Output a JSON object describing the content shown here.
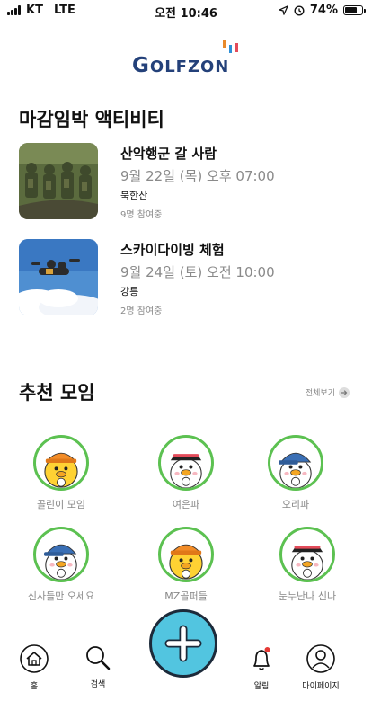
{
  "status_bar": {
    "carrier": "KT",
    "network": "LTE",
    "time": "오전 10:46",
    "battery": "74%"
  },
  "logo": {
    "text_first": "G",
    "text_rest": "OLFZON"
  },
  "deadline": {
    "title": "마감임박 액티비티",
    "items": [
      {
        "title": "산악행군 갈 사람",
        "date": "9월 22일 (목) 오후 07:00",
        "location": "북한산",
        "participants": "9명 참여중"
      },
      {
        "title": "스카이다이빙 체험",
        "date": "9월 24일 (토) 오전 10:00",
        "location": "강릉",
        "participants": "2명 참여중"
      }
    ]
  },
  "recommended": {
    "title": "추천 모임",
    "see_all": "전체보기",
    "groups": [
      {
        "name": "골린이 모임",
        "hat": "orange"
      },
      {
        "name": "여은파",
        "hat": "visor"
      },
      {
        "name": "오리파",
        "hat": "blue"
      },
      {
        "name": "신사들만 오세요",
        "hat": "blue"
      },
      {
        "name": "MZ골퍼들",
        "hat": "orange"
      },
      {
        "name": "눈누난나 신나",
        "hat": "visor"
      }
    ]
  },
  "nav": {
    "home": "홈",
    "search": "검색",
    "alerts": "알림",
    "mypage": "마이페이지"
  },
  "colors": {
    "logo_navy": "#24417a",
    "accent_green": "#5cc151",
    "fab_blue": "#52c5e0",
    "alert_dot": "#e53935"
  }
}
